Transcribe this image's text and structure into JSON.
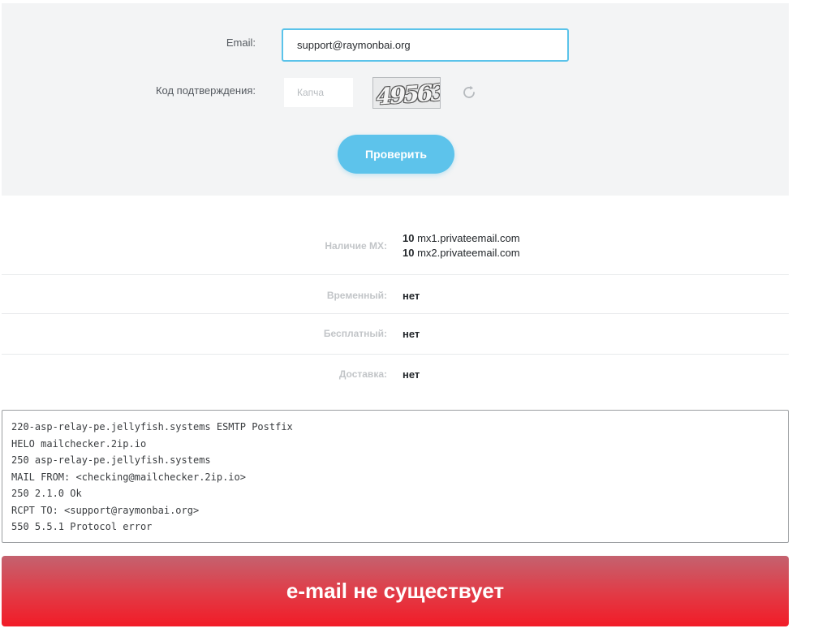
{
  "form": {
    "email_label": "Email:",
    "email_value": "support@raymonbai.org",
    "code_label": "Код подтверждения:",
    "captcha_placeholder": "Капча",
    "captcha_image_text": "49563",
    "refresh_icon": "refresh-icon",
    "verify_button": "Проверить",
    "accent_color": "#5dc3eb"
  },
  "results": {
    "mx_label": "Наличие MX:",
    "mx_records": [
      {
        "priority": "10",
        "host": "mx1.privateemail.com"
      },
      {
        "priority": "10",
        "host": "mx2.privateemail.com"
      }
    ],
    "temporary_label": "Временный:",
    "temporary_value": "нет",
    "free_label": "Бесплатный:",
    "free_value": "нет",
    "delivery_label": "Доставка:",
    "delivery_value": "нет"
  },
  "smtp_log": [
    "220-asp-relay-pe.jellyfish.systems ESMTP Postfix",
    "HELO mailchecker.2ip.io",
    "250 asp-relay-pe.jellyfish.systems",
    "MAIL FROM: <checking@mailchecker.2ip.io>",
    "250 2.1.0 Ok",
    "RCPT TO: <support@raymonbai.org>",
    "550 5.5.1 Protocol error"
  ],
  "banner": {
    "text": "e-mail не существует",
    "color": "#f21b27"
  }
}
